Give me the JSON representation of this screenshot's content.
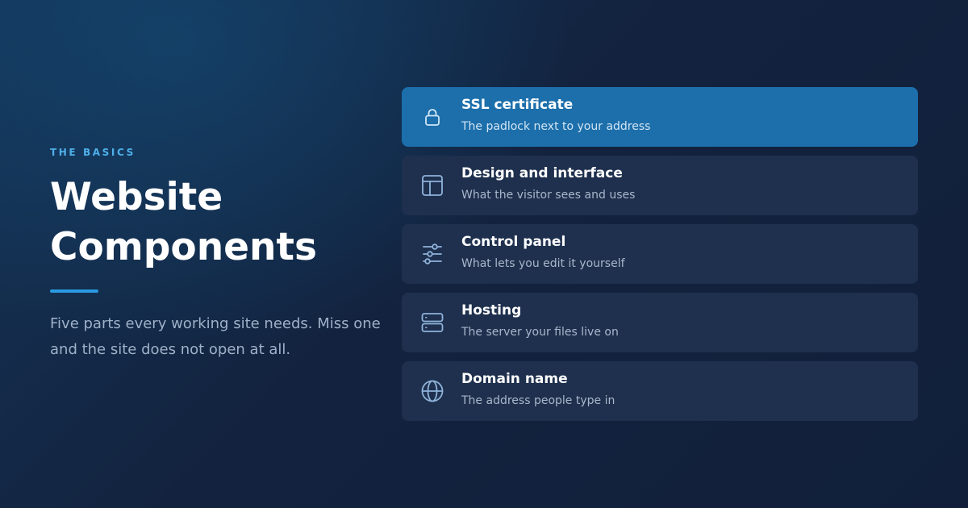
{
  "intro": {
    "eyebrow": "THE BASICS",
    "title_lines": [
      "Website",
      "Components"
    ],
    "description_lines": [
      "Five parts every working site needs. Miss one",
      "and the site does not open at all."
    ]
  },
  "components": [
    {
      "title": "SSL certificate",
      "subtitle": "The padlock next to your address",
      "icon": "padlock-icon",
      "active": true
    },
    {
      "title": "Design and interface",
      "subtitle": "What the visitor sees and uses",
      "icon": "layout-icon",
      "active": false
    },
    {
      "title": "Control panel",
      "subtitle": "What lets you edit it yourself",
      "icon": "sliders-icon",
      "active": false
    },
    {
      "title": "Hosting",
      "subtitle": "The server your files live on",
      "icon": "server-icon",
      "active": false
    },
    {
      "title": "Domain name",
      "subtitle": "The address people type in",
      "icon": "globe-icon",
      "active": false
    }
  ],
  "colors": {
    "accent": "#2a9ae0",
    "eyebrow": "#4fb0ea",
    "active_card": "#1c6fab",
    "card": "#1e304d",
    "background": "#13223f"
  }
}
